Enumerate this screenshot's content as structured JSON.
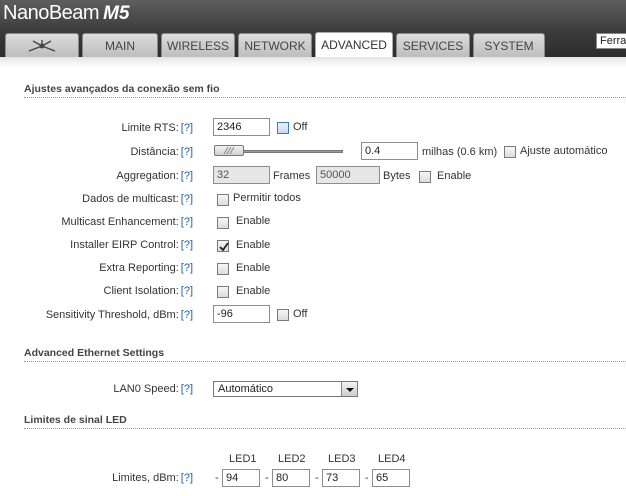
{
  "header": {
    "brand": "NanoBeam",
    "model": "M5",
    "tabs": [
      {
        "label": "",
        "icon": "ubiquiti-logo-icon"
      },
      {
        "label": "MAIN"
      },
      {
        "label": "WIRELESS"
      },
      {
        "label": "NETWORK"
      },
      {
        "label": "ADVANCED",
        "active": true
      },
      {
        "label": "SERVICES"
      },
      {
        "label": "SYSTEM"
      }
    ],
    "tools_select": "Ferra"
  },
  "wireless_section": {
    "title": "Ajustes avançados da conexão sem fio",
    "help": "[?]",
    "rts": {
      "label": "Limite RTS:",
      "value": "2346",
      "check_label": "Off"
    },
    "distance": {
      "label": "Distância:",
      "value": "0.4",
      "unit": "milhas (0.6 km)",
      "check_label": "Ajuste automático"
    },
    "aggregation": {
      "label": "Aggregation:",
      "frames_value": "32",
      "frames_label": "Frames",
      "bytes_value": "50000",
      "bytes_label": "Bytes",
      "check_label": "Enable"
    },
    "multicast": {
      "label": "Dados de multicast:",
      "check_label": "Permitir todos"
    },
    "multicast_enh": {
      "label": "Multicast Enhancement:",
      "check_label": "Enable"
    },
    "installer_eirp": {
      "label": "Installer EIRP Control:",
      "check_label": "Enable",
      "checked": true
    },
    "extra_reporting": {
      "label": "Extra Reporting:",
      "check_label": "Enable"
    },
    "client_isolation": {
      "label": "Client Isolation:",
      "check_label": "Enable"
    },
    "sensitivity": {
      "label": "Sensitivity Threshold, dBm:",
      "value": "-96",
      "check_label": "Off"
    }
  },
  "ethernet_section": {
    "title": "Advanced Ethernet Settings",
    "lan0": {
      "label": "LAN0 Speed:",
      "value": "Automático"
    }
  },
  "led_section": {
    "title": "Limites de sinal LED",
    "row_label": "Limites, dBm:",
    "dash": "-",
    "leds": [
      {
        "name": "LED1",
        "value": "94"
      },
      {
        "name": "LED2",
        "value": "80"
      },
      {
        "name": "LED3",
        "value": "73"
      },
      {
        "name": "LED4",
        "value": "65"
      }
    ]
  }
}
